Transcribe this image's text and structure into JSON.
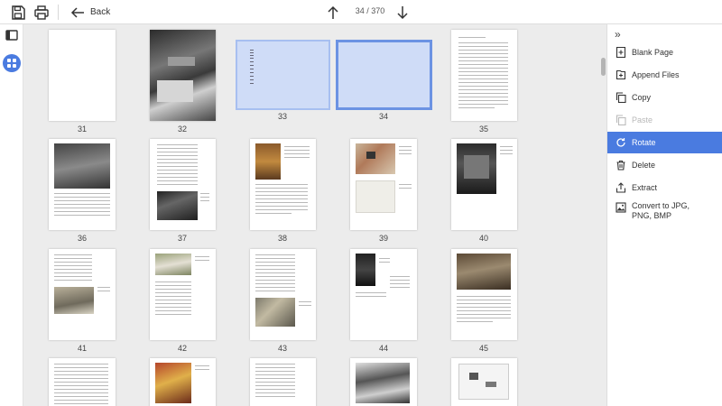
{
  "toolbar": {
    "back_label": "Back",
    "page_indicator": "34 / 370"
  },
  "pages": [
    {
      "num": "31"
    },
    {
      "num": "32"
    },
    {
      "num": "33"
    },
    {
      "num": "34"
    },
    {
      "num": "35"
    },
    {
      "num": "36"
    },
    {
      "num": "37"
    },
    {
      "num": "38"
    },
    {
      "num": "39"
    },
    {
      "num": "40"
    },
    {
      "num": "41"
    },
    {
      "num": "42"
    },
    {
      "num": "43"
    },
    {
      "num": "44"
    },
    {
      "num": "45"
    }
  ],
  "right_panel": {
    "items": [
      {
        "label": "Blank Page",
        "icon": "blank-page-icon",
        "state": "normal"
      },
      {
        "label": "Append Files",
        "icon": "append-files-icon",
        "state": "normal"
      },
      {
        "label": "Copy",
        "icon": "copy-icon",
        "state": "normal"
      },
      {
        "label": "Paste",
        "icon": "paste-icon",
        "state": "disabled"
      },
      {
        "label": "Rotate",
        "icon": "rotate-icon",
        "state": "active"
      },
      {
        "label": "Delete",
        "icon": "trash-icon",
        "state": "normal"
      },
      {
        "label": "Extract",
        "icon": "extract-icon",
        "state": "normal"
      },
      {
        "label": "Convert to JPG, PNG, BMP",
        "icon": "image-icon",
        "state": "normal"
      }
    ]
  },
  "colors": {
    "accent": "#4a7be0",
    "selection_fill": "#cfdcf7"
  }
}
